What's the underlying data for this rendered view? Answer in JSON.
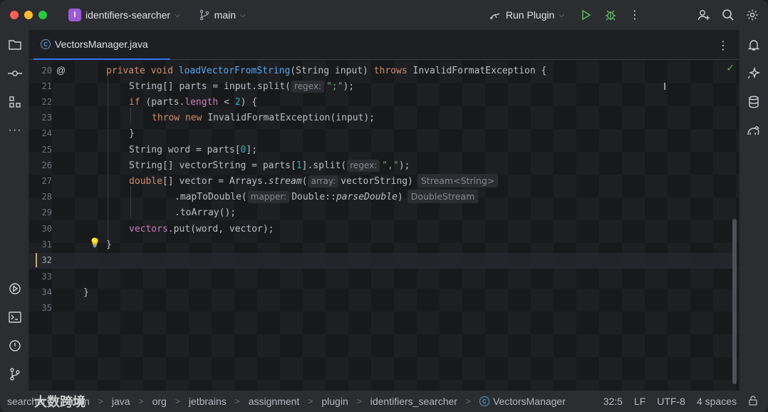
{
  "titlebar": {
    "project_badge": "I",
    "project_name": "identifiers-searcher",
    "branch": "main",
    "run_config": "Run Plugin"
  },
  "tab": {
    "filename": "VectorsManager.java"
  },
  "editor": {
    "line_numbers": [
      "20",
      "21",
      "22",
      "23",
      "24",
      "25",
      "26",
      "27",
      "28",
      "29",
      "30",
      "31",
      "32",
      "33",
      "34",
      "35"
    ],
    "current_line": "32",
    "hints": {
      "regex1": "regex:",
      "regex2": "regex:",
      "array": "array:",
      "mapper": "mapper:",
      "stream_type": "Stream<String>",
      "double_stream": "DoubleStream"
    }
  },
  "statusbar": {
    "watermark": "大数跨境",
    "breadcrumbs": [
      "searcher",
      "main",
      "java",
      "org",
      "jetbrains",
      "assignment",
      "plugin",
      "identifiers_searcher",
      "VectorsManager"
    ],
    "position": "32:5",
    "line_sep": "LF",
    "encoding": "UTF-8",
    "indent": "4 spaces"
  },
  "colors": {
    "accent": "#3574f0",
    "keyword": "#cf8e6d",
    "function": "#56a8f5",
    "string": "#6aab73",
    "number": "#2aacb8"
  }
}
